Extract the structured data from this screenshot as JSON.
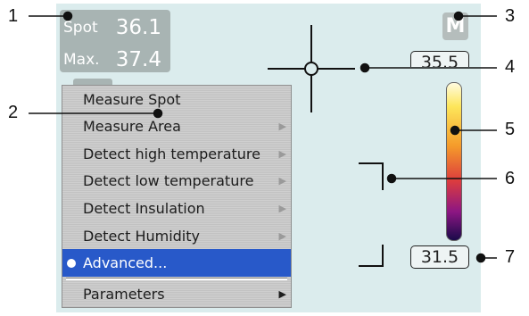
{
  "readout": {
    "spot_label": "Spot",
    "spot_value": "36.1",
    "max_label": "Max.",
    "max_value": "37.4"
  },
  "mode_badge": "M",
  "temperature_scale": {
    "max_value": "35.5",
    "min_value": "31.5",
    "colors": [
      "#fffbe0",
      "#fde65a",
      "#f59b2a",
      "#dd3d3d",
      "#8c1683",
      "#1a0a4a"
    ]
  },
  "menu": {
    "items": [
      {
        "label": "Measure Spot",
        "submenu": false
      },
      {
        "label": "Measure Area",
        "submenu": true
      },
      {
        "label": "Detect high temperature",
        "submenu": true
      },
      {
        "label": "Detect low temperature",
        "submenu": true
      },
      {
        "label": "Detect Insulation",
        "submenu": true
      },
      {
        "label": "Detect Humidity",
        "submenu": true
      },
      {
        "label": "Advanced...",
        "submenu": false,
        "selected": true
      }
    ],
    "footer_item": {
      "label": "Parameters",
      "submenu": true
    },
    "selected_color": "#2859c9"
  },
  "callouts": {
    "c1": "1",
    "c2": "2",
    "c3": "3",
    "c4": "4",
    "c5": "5",
    "c6": "6",
    "c7": "7"
  }
}
